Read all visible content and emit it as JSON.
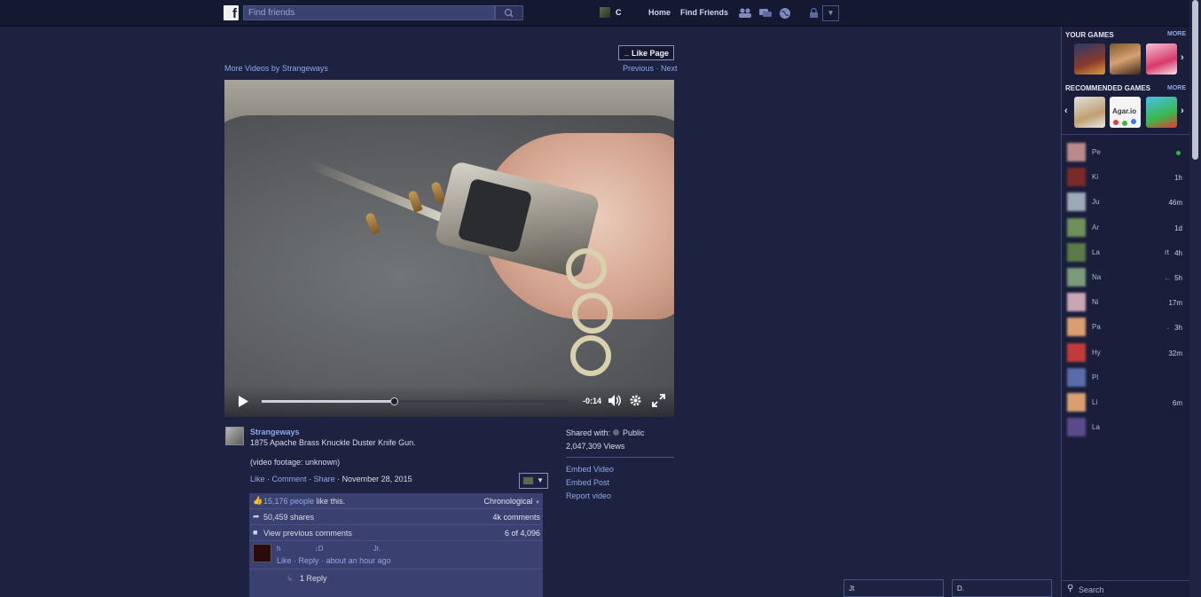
{
  "topbar": {
    "logo": "f",
    "search_placeholder": "Find friends",
    "username": "C",
    "nav": [
      "Home",
      "Find Friends"
    ]
  },
  "page": {
    "like_page_label": "Like Page",
    "like_page_prefix": "_",
    "more_videos": "More Videos by Strangeways",
    "previous": "Previous",
    "separator": "·",
    "next": "Next"
  },
  "video": {
    "time_remaining": "-0:14",
    "progress_fraction": 0.43
  },
  "post": {
    "author": "Strangeways",
    "title": "1875 Apache Brass Knuckle Duster Knife Gun.",
    "footage_note": "(video footage: unknown)",
    "actions": {
      "like": "Like",
      "comment": "Comment",
      "share": "Share",
      "date": "November 28, 2015"
    }
  },
  "engagement": {
    "likes_link": "15,176 people",
    "likes_suffix": " like this.",
    "sort": "Chronological",
    "shares": "50,459 shares",
    "comments_count": "4k comments",
    "view_previous": "View previous comments",
    "comment_position": "6 of 4,096"
  },
  "comment": {
    "name_parts": [
      "h",
      "↓D",
      "Jr."
    ],
    "like": "Like",
    "reply": "Reply",
    "time": "about an hour ago",
    "replies": "1 Reply"
  },
  "sidebar_info": {
    "shared_with_label": "Shared with:",
    "shared_with_value": "Public",
    "views": "2,047,309 Views",
    "links": [
      "Embed Video",
      "Embed Post",
      "Report video"
    ]
  },
  "games": {
    "your_games_heading": "YOUR GAMES",
    "recommended_heading": "RECOMMENDED GAMES",
    "more": "MORE",
    "agar_label": "Agar.io"
  },
  "friends": [
    {
      "name": "Pe",
      "time": "",
      "extra": "",
      "online": true,
      "color": "#b98a8a"
    },
    {
      "name": "Ki",
      "time": "1h",
      "extra": "",
      "online": false,
      "color": "#7a2a28"
    },
    {
      "name": "Ju",
      "time": "46m",
      "extra": "",
      "online": false,
      "color": "#9da8b8"
    },
    {
      "name": "Ar",
      "time": "1d",
      "extra": "",
      "online": false,
      "color": "#6f8f5a"
    },
    {
      "name": "La",
      "time": "4h",
      "extra": "rt",
      "online": false,
      "color": "#5a7a48"
    },
    {
      "name": "Na",
      "time": "5h",
      "extra": "..",
      "online": false,
      "color": "#7b9a7a"
    },
    {
      "name": "Ni",
      "time": "17m",
      "extra": "",
      "online": false,
      "color": "#c9a7b2"
    },
    {
      "name": "Pa",
      "time": "3h",
      "extra": ".",
      "online": false,
      "color": "#d8a070"
    },
    {
      "name": "Hy",
      "time": "32m",
      "extra": "",
      "online": false,
      "color": "#c23b3b"
    },
    {
      "name": "Pl",
      "time": "",
      "extra": "",
      "online": false,
      "color": "#5b6aa8"
    },
    {
      "name": "Li",
      "time": "6m",
      "extra": "",
      "online": false,
      "color": "#d8a070"
    },
    {
      "name": "La",
      "time": "",
      "extra": "",
      "online": false,
      "color": "#5a4a8a"
    }
  ],
  "sidebar_search": "Search",
  "chat_tabs": [
    "Jt",
    "D."
  ]
}
